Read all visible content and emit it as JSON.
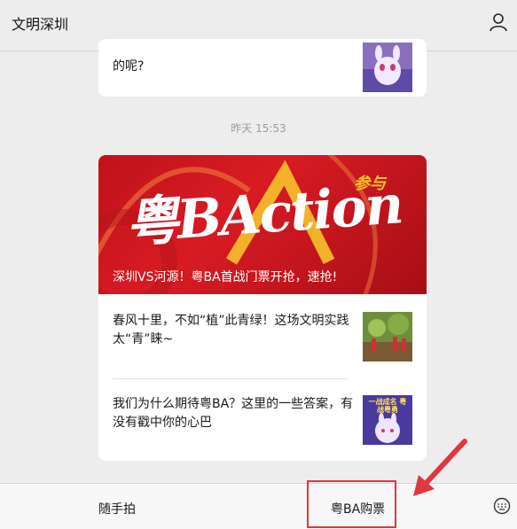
{
  "header": {
    "title": "文明深圳",
    "profile_icon": "person-icon"
  },
  "prev_card": {
    "text": "的呢?"
  },
  "timestamp": "昨天 15:53",
  "article_card": {
    "hero_logo_main": "粤BAction",
    "hero_logo_badge": "参与",
    "hero_caption": "深圳VS河源！粤BA首战门票开抢，速抢!",
    "items": [
      {
        "text": "春风十里，不如“植”此青绿！这场文明实践太“青”睐~"
      },
      {
        "text": "我们为什么期待粤BA？这里的一些答案，有没有戳中你的心巴",
        "thumb_text": "一战成名 粤战粤勇"
      }
    ]
  },
  "bottom_menu": {
    "item1": "随手拍",
    "item2": "粤BA购票",
    "keyboard_icon": "keyboard-icon"
  },
  "colors": {
    "accent_red": "#e0373f",
    "hero_red": "#d81b23",
    "background": "#ededed"
  }
}
